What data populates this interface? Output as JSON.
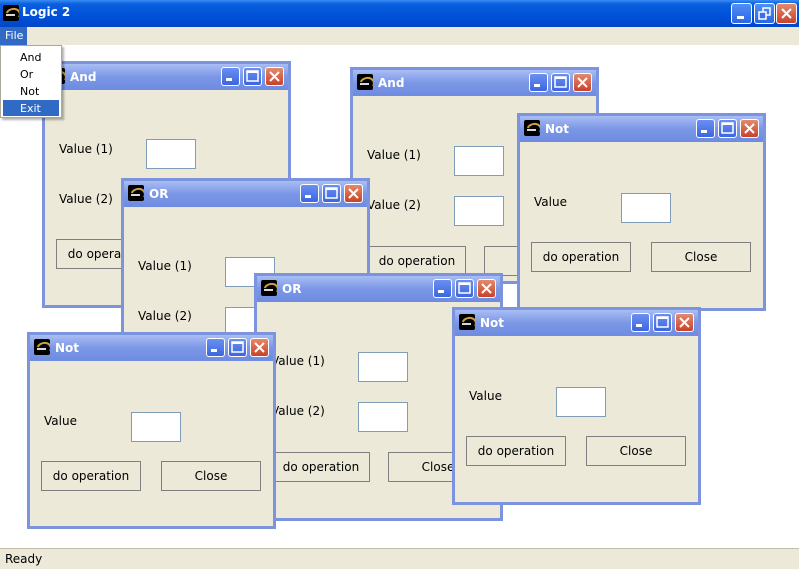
{
  "app": {
    "title": "Logic 2"
  },
  "menu": {
    "file_label": "File",
    "items": [
      "And",
      "Or",
      "Not",
      "Exit"
    ],
    "selected_item": "Exit"
  },
  "status": {
    "text": "Ready"
  },
  "frames": {
    "and_a": {
      "title": "And",
      "value1_label": "Value (1)",
      "value2_label": "Value (2)",
      "do_label": "do operation"
    },
    "and_b": {
      "title": "And",
      "value1_label": "Value (1)",
      "value2_label": "Value (2)",
      "do_label": "do operation"
    },
    "or_a": {
      "title": "OR",
      "value1_label": "Value (1)",
      "value2_label": "Value (2)"
    },
    "or_b": {
      "title": "OR",
      "value1_label": "Value (1)",
      "value2_label": "Value (2)",
      "do_label": "do operation",
      "close_label": "Close"
    },
    "not_a": {
      "title": "Not",
      "value_label": "Value",
      "do_label": "do operation",
      "close_label": "Close"
    },
    "not_b": {
      "title": "Not",
      "value_label": "Value",
      "do_label": "do operation",
      "close_label": "Close"
    },
    "not_c": {
      "title": "Not",
      "value_label": "Value",
      "do_label": "do operation",
      "close_label": "Close"
    }
  },
  "colors": {
    "titlebar": "#0050d8",
    "frame_title": "#7b97e6",
    "selection": "#316ac5",
    "window_bg": "#ece9d8"
  }
}
